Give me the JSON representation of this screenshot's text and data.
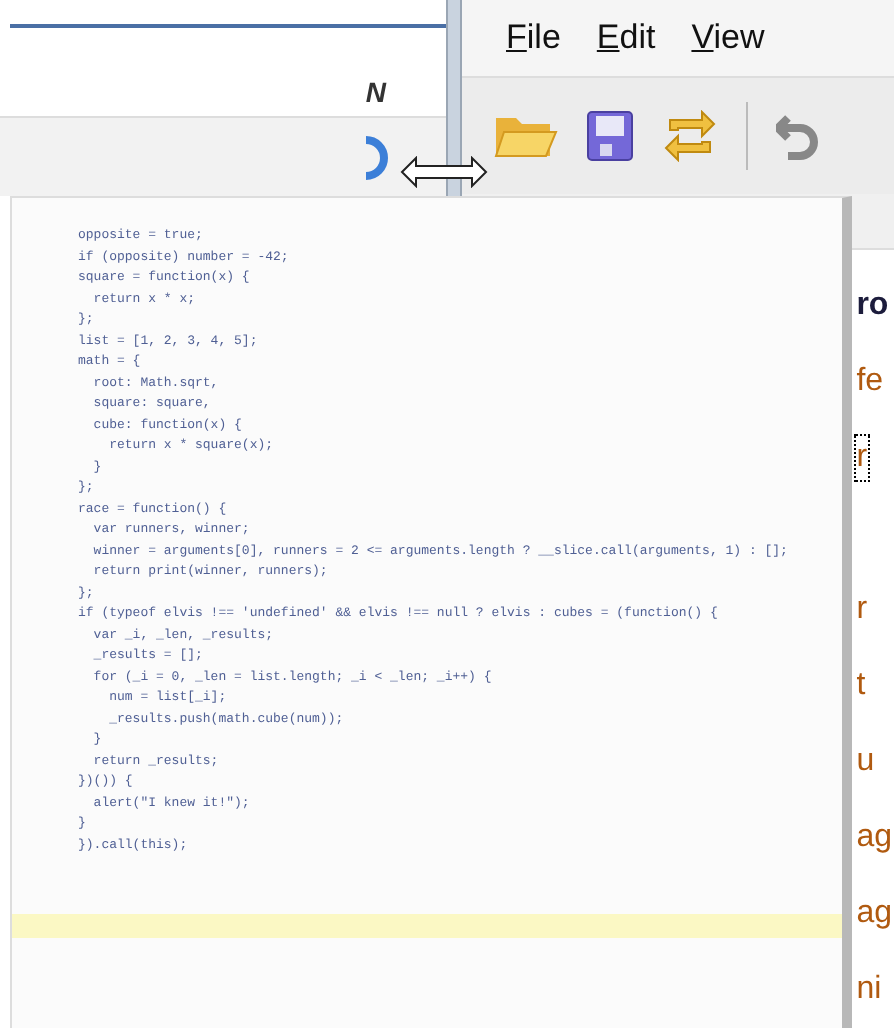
{
  "left_window": {
    "title_fragment": "N"
  },
  "menu": [
    "File",
    "Edit",
    "View"
  ],
  "right_window": {
    "tree": [
      {
        "label": "ro",
        "selected": false,
        "color": "#1c1c3c",
        "children": [
          {
            "label": "fe",
            "selected": false,
            "color": "#b05a10",
            "children": [
              {
                "label": "r",
                "selected": true,
                "color": "#b05a10"
              }
            ]
          },
          {
            "children": [
              {
                "label": "r",
                "selected": false,
                "color": "#b05a10"
              }
            ]
          },
          {
            "label": "t",
            "selected": false,
            "color": "#b05a10",
            "children": [
              {
                "label": "u",
                "selected": false,
                "color": "#b05a10"
              }
            ]
          },
          {
            "label": "ag",
            "selected": false,
            "color": "#b05a10"
          },
          {
            "label": "ag",
            "selected": false,
            "color": "#b05a10"
          },
          {
            "label": "ni",
            "selected": false,
            "color": "#b05a10"
          }
        ]
      }
    ]
  },
  "code_overlay": {
    "lines": [
      "opposite = true;",
      "if (opposite) number = -42;",
      "square = function(x) {",
      "  return x * x;",
      "};",
      "list = [1, 2, 3, 4, 5];",
      "math = {",
      "  root: Math.sqrt,",
      "  square: square,",
      "  cube: function(x) {",
      "    return x * square(x);",
      "  }",
      "};",
      "race = function() {",
      "  var runners, winner;",
      "  winner = arguments[0], runners = 2 <= arguments.length ? __slice.call(arguments, 1) : [];",
      "  return print(winner, runners);",
      "};",
      "if (typeof elvis !== 'undefined' && elvis !== null ? elvis : cubes = (function() {",
      "  var _i, _len, _results;",
      "  _results = [];",
      "  for (_i = 0, _len = list.length; _i < _len; _i++) {",
      "    num = list[_i];",
      "    _results.push(math.cube(num));",
      "  }",
      "  return _results;",
      "})()) {",
      "  alert(\"I knew it!\");",
      "}",
      "}).call(this);"
    ]
  }
}
